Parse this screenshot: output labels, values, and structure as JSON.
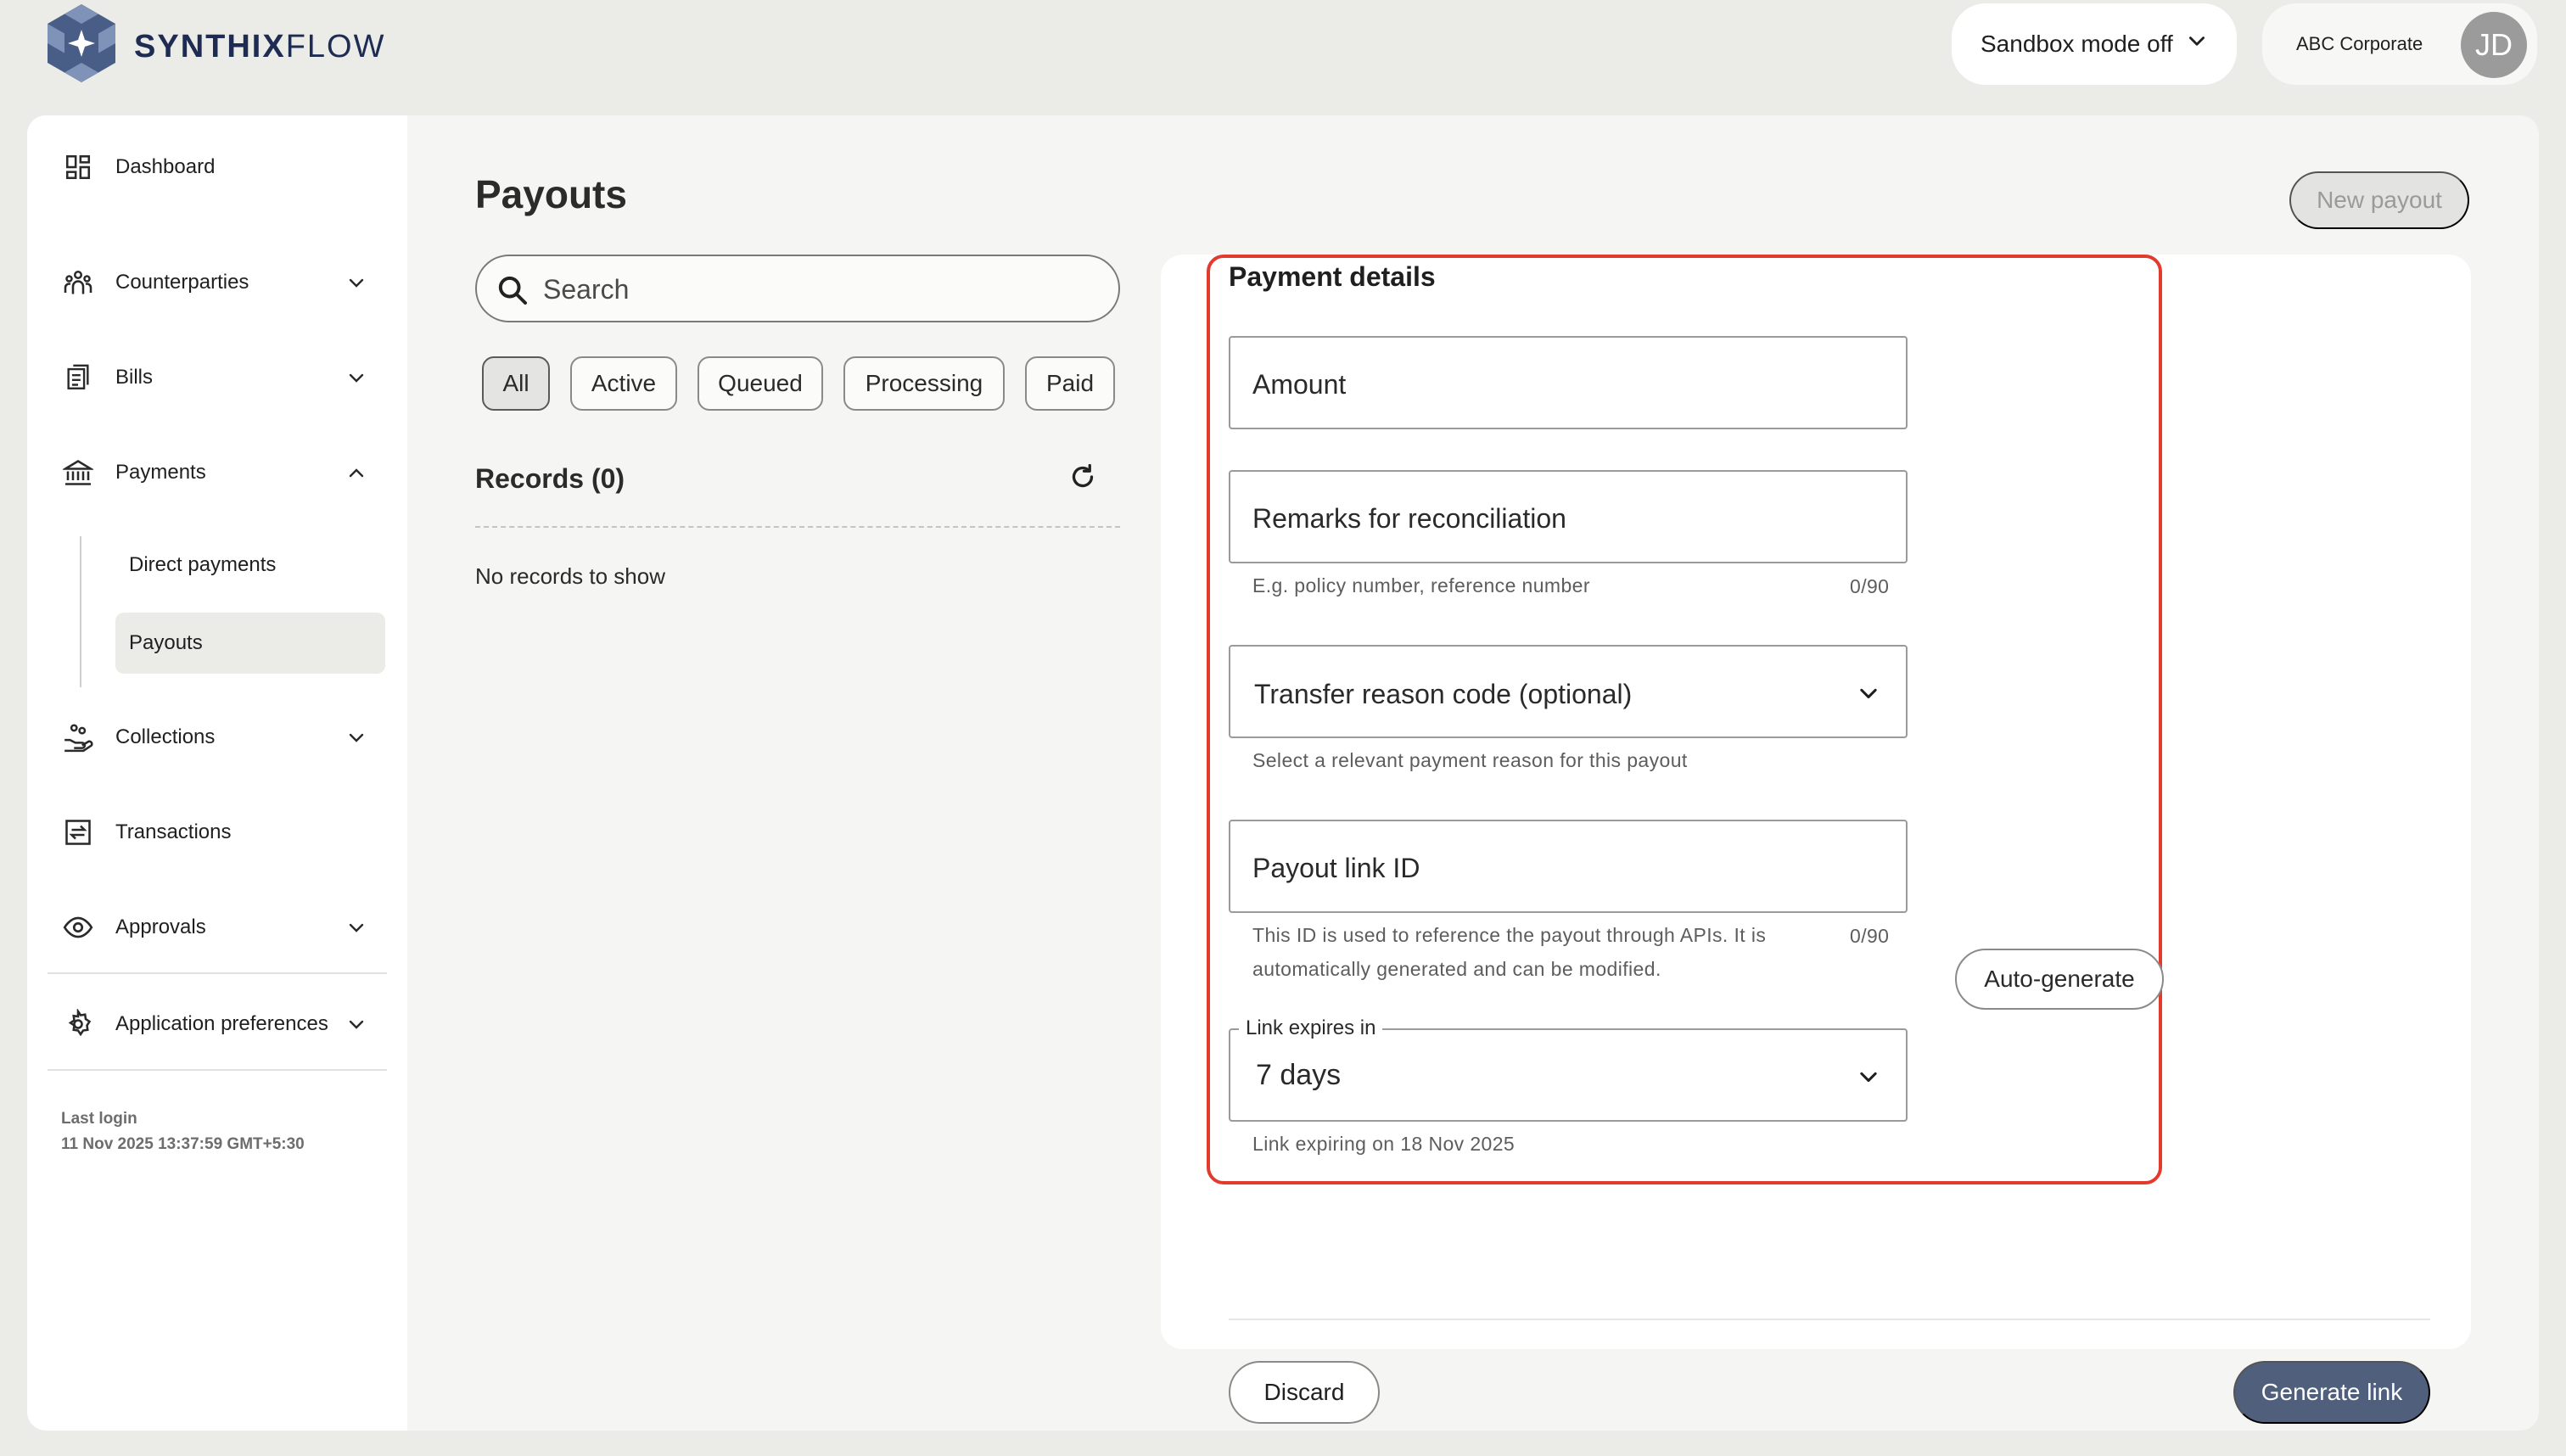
{
  "brand": {
    "name_bold": "SYNTHIX",
    "name_light": "FLOW"
  },
  "header": {
    "sandbox_label": "Sandbox mode off",
    "account_name": "ABC Corporate",
    "avatar_initials": "JD"
  },
  "sidebar": {
    "items": [
      {
        "label": "Dashboard"
      },
      {
        "label": "Counterparties"
      },
      {
        "label": "Bills"
      },
      {
        "label": "Payments"
      },
      {
        "label": "Collections"
      },
      {
        "label": "Transactions"
      },
      {
        "label": "Approvals"
      },
      {
        "label": "Application preferences"
      }
    ],
    "payments_sub": [
      {
        "label": "Direct payments"
      },
      {
        "label": "Payouts"
      }
    ],
    "last_login_label": "Last login",
    "last_login_value": "11 Nov 2025 13:37:59 GMT+5:30"
  },
  "main": {
    "title": "Payouts",
    "new_payout_label": "New payout",
    "search_placeholder": "Search",
    "filters": [
      "All",
      "Active",
      "Queued",
      "Processing",
      "Paid"
    ],
    "selected_filter": "All",
    "records_title": "Records (0)",
    "empty_text": "No records to show"
  },
  "payment_details": {
    "title": "Payment details",
    "amount_placeholder": "Amount",
    "remarks_placeholder": "Remarks for reconciliation",
    "remarks_helper": "E.g. policy number, reference number",
    "remarks_counter": "0/90",
    "transfer_reason_label": "Transfer reason code (optional)",
    "transfer_reason_helper": "Select a relevant payment reason for this payout",
    "payout_link_placeholder": "Payout link ID",
    "auto_generate_label": "Auto-generate",
    "payout_link_helper_1": "This ID is used to reference the payout through APIs. It is",
    "payout_link_helper_2": "automatically generated and can be modified.",
    "payout_link_counter": "0/90",
    "expiry_label": "Link expires in",
    "expiry_value": "7 days",
    "expiry_helper": "Link expiring on 18 Nov 2025",
    "discard_label": "Discard",
    "generate_label": "Generate link"
  },
  "colors": {
    "highlight": "#e23b2e",
    "primary_button": "#4f5f7c",
    "brand_text": "#1e2b52"
  }
}
